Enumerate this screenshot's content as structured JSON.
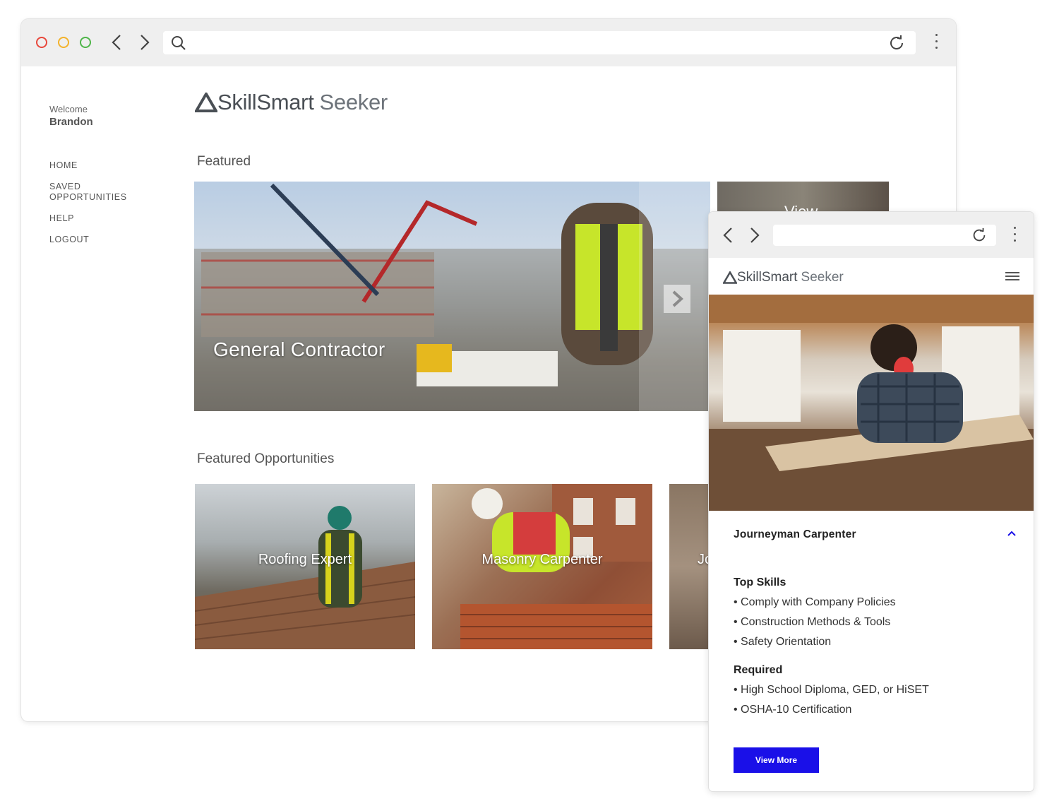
{
  "desktop": {
    "sidebar": {
      "welcome": "Welcome",
      "username": "Brandon",
      "menu": [
        "HOME",
        "SAVED OPPORTUNITIES",
        "HELP",
        "LOGOUT"
      ]
    },
    "brand": {
      "name1": "SkillSmart",
      "name2": "Seeker"
    },
    "featured_heading": "Featured",
    "hero_label": "General Contractor",
    "peek_label": "View",
    "opportunities_heading": "Featured Opportunities",
    "cards": [
      "Roofing Expert",
      "Masonry Carpenter",
      "Jo"
    ]
  },
  "mobile": {
    "brand": {
      "name1": "SkillSmart",
      "name2": "Seeker"
    },
    "job_title": "Journeyman Carpenter",
    "top_skills_heading": "Top Skills",
    "top_skills": [
      "• Comply with Company Policies",
      "• Construction Methods & Tools",
      "• Safety Orientation"
    ],
    "required_heading": "Required",
    "required": [
      "• High School Diploma, GED, or HiSET",
      "• OSHA-10 Certification"
    ],
    "view_more_label": "View More"
  },
  "colors": {
    "accent_blue": "#1a10e8",
    "traffic_red": "#e8463a",
    "traffic_yellow": "#f3b22a",
    "traffic_green": "#4eb548",
    "brand_gray": "#4a4f55"
  }
}
